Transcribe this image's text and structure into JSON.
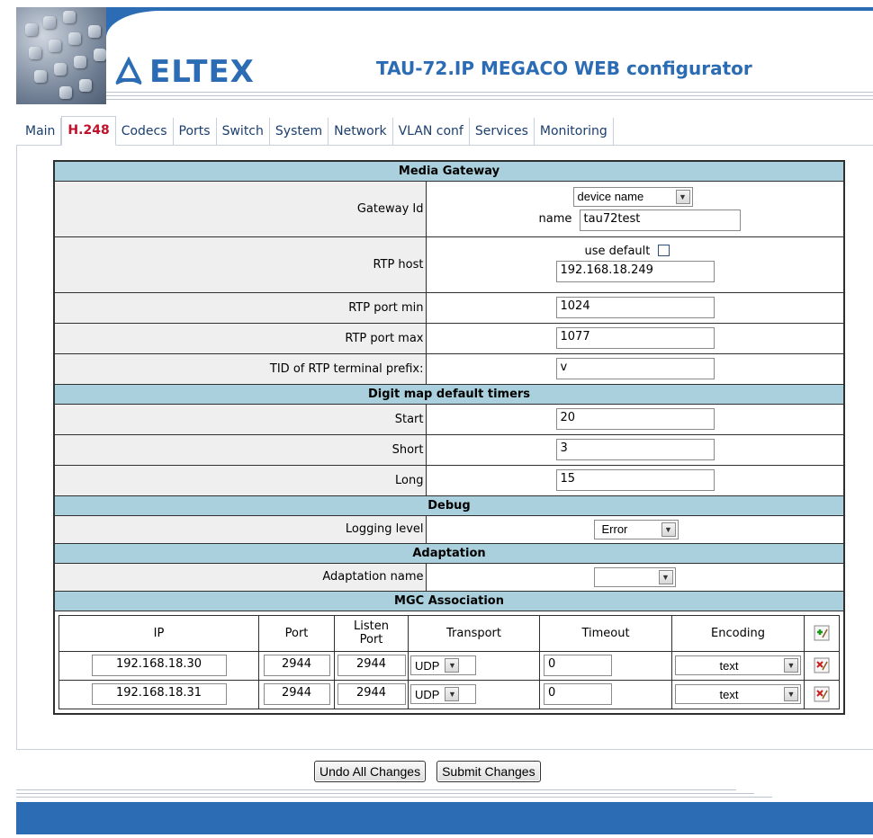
{
  "brand": {
    "logo_text": "ELTEX",
    "title": "TAU-72.IP MEGACO WEB configurator"
  },
  "tabs": [
    {
      "label": "Main",
      "active": false
    },
    {
      "label": "H.248",
      "active": true
    },
    {
      "label": "Codecs",
      "active": false
    },
    {
      "label": "Ports",
      "active": false
    },
    {
      "label": "Switch",
      "active": false
    },
    {
      "label": "System",
      "active": false
    },
    {
      "label": "Network",
      "active": false
    },
    {
      "label": "VLAN conf",
      "active": false
    },
    {
      "label": "Services",
      "active": false
    },
    {
      "label": "Monitoring",
      "active": false
    }
  ],
  "media_gateway": {
    "section_title": "Media Gateway",
    "gateway_id": {
      "label": "Gateway Id",
      "type_value": "device name",
      "name_label": "name",
      "name_value": "tau72test"
    },
    "rtp_host": {
      "label": "RTP host",
      "use_default_label": "use default",
      "use_default_checked": false,
      "value": "192.168.18.249"
    },
    "rtp_port_min": {
      "label": "RTP port min",
      "value": "1024"
    },
    "rtp_port_max": {
      "label": "RTP port max",
      "value": "1077"
    },
    "tid_prefix": {
      "label": "TID of RTP terminal prefix:",
      "value": "v"
    }
  },
  "digit_map": {
    "section_title": "Digit map default timers",
    "start": {
      "label": "Start",
      "value": "20"
    },
    "short": {
      "label": "Short",
      "value": "3"
    },
    "long": {
      "label": "Long",
      "value": "15"
    }
  },
  "debug": {
    "section_title": "Debug",
    "logging_level": {
      "label": "Logging level",
      "value": "Error"
    }
  },
  "adaptation": {
    "section_title": "Adaptation",
    "adaptation_name": {
      "label": "Adaptation name",
      "value": ""
    }
  },
  "mgc": {
    "section_title": "MGC Association",
    "headers": {
      "ip": "IP",
      "port": "Port",
      "listen_port_line1": "Listen",
      "listen_port_line2": "Port",
      "transport": "Transport",
      "timeout": "Timeout",
      "encoding": "Encoding"
    },
    "rows": [
      {
        "ip": "192.168.18.30",
        "port": "2944",
        "listen_port": "2944",
        "transport": "UDP",
        "timeout": "0",
        "encoding": "text"
      },
      {
        "ip": "192.168.18.31",
        "port": "2944",
        "listen_port": "2944",
        "transport": "UDP",
        "timeout": "0",
        "encoding": "text"
      }
    ]
  },
  "actions": {
    "undo_label": "Undo All Changes",
    "submit_label": "Submit Changes"
  },
  "colors": {
    "brand_blue": "#2c6cb4",
    "active_tab": "#c0102a",
    "section_bg": "#a9d0dc",
    "label_bg": "#efefef"
  },
  "icons": {
    "add_row": "add-row-icon",
    "delete_row": "delete-row-icon",
    "dropdown": "chevron-down-icon"
  }
}
